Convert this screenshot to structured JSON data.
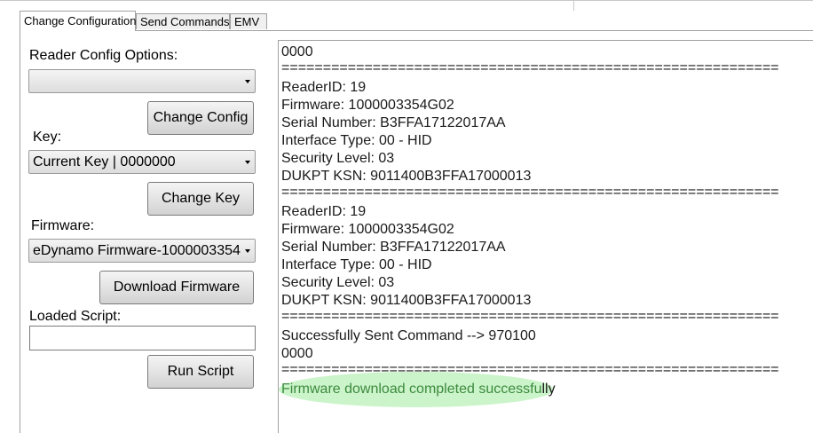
{
  "tabs": [
    {
      "label": "Change Configuration",
      "active": true
    },
    {
      "label": "Send Commands",
      "active": false
    },
    {
      "label": "EMV",
      "active": false
    }
  ],
  "left_panel": {
    "reader_config_label": "Reader Config Options:",
    "reader_config_value": "",
    "change_config_button": "Change Config",
    "key_label": "Key:",
    "key_value": "Current Key | 0000000",
    "change_key_button": "Change Key",
    "firmware_label": "Firmware:",
    "firmware_value": "eDynamo Firmware-1000003354",
    "download_firmware_button": "Download Firmware",
    "loaded_script_label": "Loaded Script:",
    "loaded_script_value": "",
    "run_script_button": "Run Script"
  },
  "output": {
    "lines": [
      "0000",
      "============================================================",
      "ReaderID: 19",
      "Firmware: 1000003354G02",
      "Serial Number: B3FFA17122017AA",
      "Interface Type: 00 - HID",
      "Security Level: 03",
      "DUKPT KSN: 9011400B3FFA17000013",
      "============================================================",
      "ReaderID: 19",
      "Firmware: 1000003354G02",
      "Serial Number: B3FFA17122017AA",
      "Interface Type: 00 - HID",
      "Security Level: 03",
      "DUKPT KSN: 9011400B3FFA17000013",
      "============================================================",
      "Successfully Sent Command --> 970100",
      "0000",
      "============================================================"
    ],
    "final_line_highlighted": "Firmware download completed successfu",
    "final_line_tail": "lly",
    "highlight_color": "#8ce68c"
  }
}
